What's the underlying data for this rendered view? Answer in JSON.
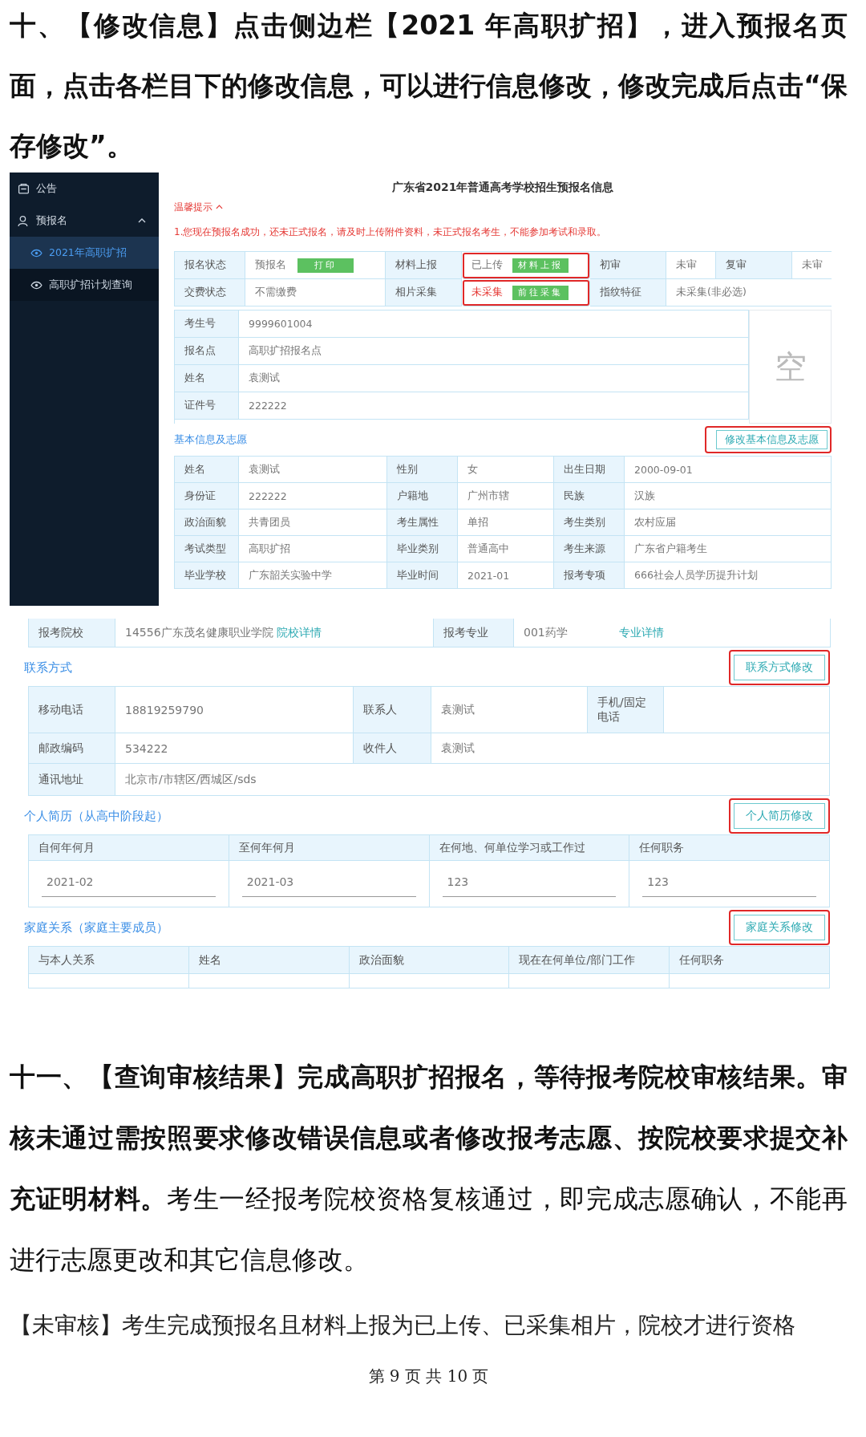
{
  "instructions_top": "十、【修改信息】点击侧边栏【2021 年高职扩招】，进入预报名页面，点击各栏目下的修改信息，可以进行信息修改，修改完成后点击“保存修改”。",
  "screenshot_registration": {
    "sidebar": {
      "items": [
        {
          "kind": "link",
          "label": "公告"
        },
        {
          "kind": "group",
          "label": "预报名",
          "expanded": true,
          "children": [
            {
              "label": "2021年高职扩招",
              "selected": true
            },
            {
              "label": "高职扩招计划查询",
              "selected": false
            }
          ]
        }
      ]
    },
    "title": "广东省2021年普通高考学校招生预报名信息",
    "tip_toggle": {
      "label": "温馨提示",
      "expanded": true
    },
    "notice": "1.您现在预报名成功，还未正式报名，请及时上传附件资料，未正式报名考生，不能参加考试和录取。",
    "status_table": {
      "rows": [
        [
          {
            "kind": "label",
            "text": "报名状态"
          },
          {
            "kind": "value",
            "text": "预报名",
            "action": "打印",
            "annotated": false
          },
          {
            "kind": "label",
            "text": "材料上报"
          },
          {
            "kind": "value",
            "text": "已上传",
            "action": "材料上报",
            "annotated": true
          },
          {
            "kind": "label",
            "text": "初审"
          },
          {
            "kind": "value",
            "text": "未审"
          },
          {
            "kind": "label",
            "text": "复审"
          },
          {
            "kind": "value",
            "text": "未审"
          }
        ],
        [
          {
            "kind": "label",
            "text": "交费状态"
          },
          {
            "kind": "value",
            "text": "不需缴费"
          },
          {
            "kind": "label",
            "text": "相片采集"
          },
          {
            "kind": "value",
            "text": "未采集",
            "alert": true,
            "action": "前往采集",
            "annotated": true
          },
          {
            "kind": "label",
            "text": "指纹特征"
          },
          {
            "kind": "value",
            "text": "未采集(非必选)",
            "wide": true
          }
        ]
      ]
    },
    "identity_table": {
      "rows": [
        {
          "label": "考生号",
          "value": "9999601004"
        },
        {
          "label": "报名点",
          "value": "高职扩招报名点"
        },
        {
          "label": "姓名",
          "value": "袁测试"
        },
        {
          "label": "证件号",
          "value": "222222"
        }
      ],
      "photo_placeholder": "空"
    },
    "basic_section": {
      "title": "基本信息及志愿",
      "edit_button": {
        "label": "修改基本信息及志愿",
        "annotated": true
      }
    },
    "basic_table": {
      "rows": [
        [
          {
            "label": "姓名",
            "value": "袁测试"
          },
          {
            "label": "性别",
            "value": "女"
          },
          {
            "label": "出生日期",
            "value": "2000-09-01"
          }
        ],
        [
          {
            "label": "身份证",
            "value": "222222"
          },
          {
            "label": "户籍地",
            "value": "广州市辖"
          },
          {
            "label": "民族",
            "value": "汉族"
          }
        ],
        [
          {
            "label": "政治面貌",
            "value": "共青团员"
          },
          {
            "label": "考生属性",
            "value": "单招"
          },
          {
            "label": "考生类别",
            "value": "农村应届"
          }
        ],
        [
          {
            "label": "考试类型",
            "value": "高职扩招"
          },
          {
            "label": "毕业类别",
            "value": "普通高中"
          },
          {
            "label": "考生来源",
            "value": "广东省户籍考生"
          }
        ],
        [
          {
            "label": "毕业学校",
            "value": "广东韶关实验中学"
          },
          {
            "label": "毕业时间",
            "value": "2021-01"
          },
          {
            "label": "报考专项",
            "value": "666社会人员学历提升计划"
          }
        ]
      ]
    }
  },
  "screenshot_details": {
    "application_row": {
      "school_label": "报考院校",
      "school": "14556广东茂名健康职业学院",
      "school_link": "院校详情",
      "major_label": "报考专业",
      "major": "001药学",
      "major_link": "专业详情"
    },
    "contact_section": {
      "title": "联系方式",
      "edit_button": {
        "label": "联系方式修改",
        "annotated": true
      }
    },
    "contact_table": {
      "rows": [
        [
          {
            "label": "移动电话",
            "value": "18819259790"
          },
          {
            "label": "联系人",
            "value": "袁测试"
          },
          {
            "label": "手机/固定电话"
          }
        ],
        [
          {
            "label": "邮政编码",
            "value": "534222"
          },
          {
            "label": "收件人",
            "value": "袁测试",
            "wide": true
          }
        ],
        [
          {
            "label": "通讯地址",
            "value": "北京市/市辖区/西城区/sds",
            "wide": true
          }
        ]
      ]
    },
    "resume_section": {
      "title": "个人简历（从高中阶段起）",
      "edit_button": {
        "label": "个人简历修改",
        "annotated": true
      }
    },
    "resume_table": {
      "columns": [
        "自何年何月",
        "至何年何月",
        "在何地、何单位学习或工作过",
        "任何职务"
      ],
      "rows": [
        [
          "2021-02",
          "2021-03",
          "123",
          "123"
        ]
      ]
    },
    "family_section": {
      "title": "家庭关系（家庭主要成员）",
      "edit_button": {
        "label": "家庭关系修改",
        "annotated": true
      }
    },
    "family_table": {
      "columns": [
        "与本人关系",
        "姓名",
        "政治面貌",
        "现在在何单位/部门工作",
        "任何职务"
      ]
    }
  },
  "instructions_review": "**十一、【查询审核结果】完成高职扩招报名，等待报考院校审核结果。审核未通过需按照要求修改错误信息或者修改报考志愿、按院校要求提交补充证明材料。**考生一经报考院校资格复核通过，即完成志愿确认，不能再进行志愿更改和其它信息修改。",
  "note_pending": "【未审核】考生完成预报名且材料上报为已上传、已采集相片，院校才进行资格",
  "page_footer": "第 9 页 共 10 页"
}
